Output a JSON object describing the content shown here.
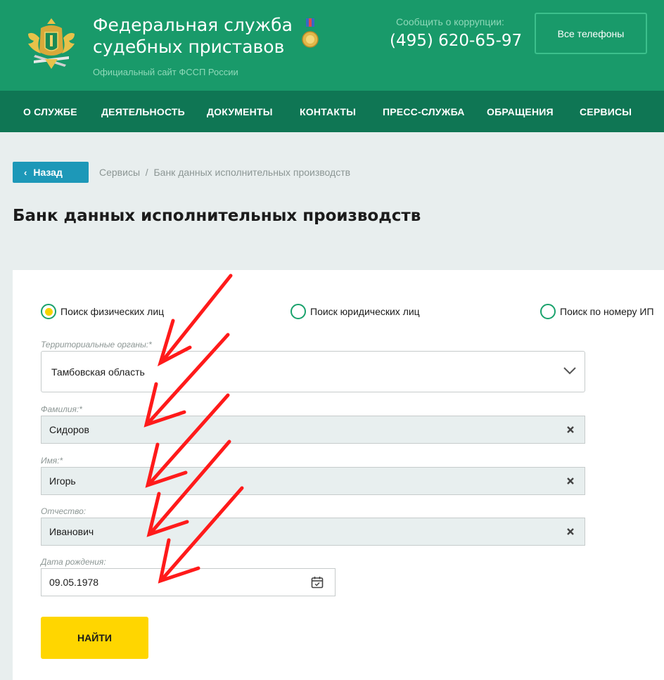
{
  "header": {
    "org_name_line1": "Федеральная служба",
    "org_name_line2": "судебных приставов",
    "org_subtitle": "Официальный сайт ФССП России",
    "corruption_label": "Сообщить о коррупции:",
    "corruption_phone": "(495) 620-65-97",
    "all_phones_label": "Все телефоны"
  },
  "nav": {
    "items": [
      "О СЛУЖБЕ",
      "ДЕЯТЕЛЬНОСТЬ",
      "ДОКУМЕНТЫ",
      "КОНТАКТЫ",
      "ПРЕСС-СЛУЖБА",
      "ОБРАЩЕНИЯ",
      "СЕРВИСЫ"
    ]
  },
  "breadcrumb": {
    "back_label": "Назад",
    "items": [
      "Сервисы",
      "Банк данных исполнительных производств"
    ],
    "separator": "/"
  },
  "page_title": "Банк данных исполнительных производств",
  "form": {
    "search_types": [
      {
        "label": "Поиск физических лиц",
        "selected": true
      },
      {
        "label": "Поиск юридических лиц",
        "selected": false
      },
      {
        "label": "Поиск по номеру ИП",
        "selected": false
      }
    ],
    "territorial_label": "Территориальные органы:*",
    "territorial_value": "Тамбовская область",
    "surname_label": "Фамилия:*",
    "surname_value": "Сидоров",
    "name_label": "Имя:*",
    "name_value": "Игорь",
    "patronymic_label": "Отчество:",
    "patronymic_value": "Иванович",
    "birthdate_label": "Дата рождения:",
    "birthdate_value": "09.05.1978",
    "submit_label": "НАЙТИ"
  },
  "colors": {
    "header_green": "#199a6a",
    "nav_green": "#0f7654",
    "back_button": "#1d98b8",
    "submit_button": "#ffd600",
    "annotation_arrow": "#ff1a1a"
  },
  "icons": [
    "emblem-icon",
    "medal-icon",
    "chevron-left-icon",
    "chevron-down-icon",
    "clear-icon",
    "calendar-icon"
  ]
}
